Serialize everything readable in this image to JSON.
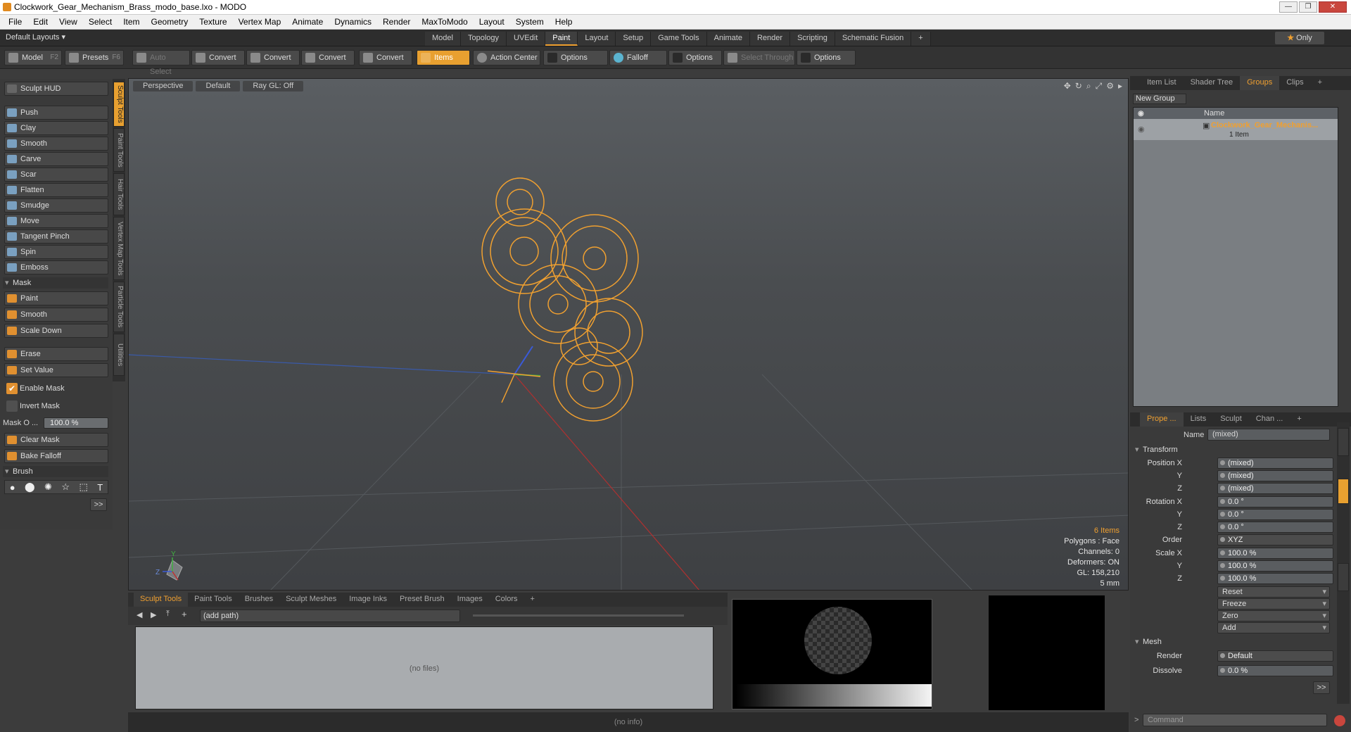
{
  "window": {
    "title": "Clockwork_Gear_Mechanism_Brass_modo_base.lxo - MODO",
    "controls": [
      "—",
      "❐",
      "✕"
    ]
  },
  "menu": [
    "File",
    "Edit",
    "View",
    "Select",
    "Item",
    "Geometry",
    "Texture",
    "Vertex Map",
    "Animate",
    "Dynamics",
    "Render",
    "MaxToModo",
    "Layout",
    "System",
    "Help"
  ],
  "layout": {
    "default_layouts": "Default Layouts ▾",
    "tabs": [
      "Model",
      "Topology",
      "UVEdit",
      "Paint",
      "Layout",
      "Setup",
      "Game Tools",
      "Animate",
      "Render",
      "Scripting",
      "Schematic Fusion",
      "+"
    ],
    "active_tab": 3,
    "only": "Only"
  },
  "toolbar": {
    "model": "Model",
    "model_key": "F2",
    "presets": "Presets",
    "presets_key": "F6",
    "auto_select": "Auto Select",
    "convert1": "Convert",
    "convert2": "Convert",
    "convert3": "Convert",
    "convert4": "Convert",
    "items": "Items",
    "action_center": "Action Center",
    "options1": "Options",
    "falloff": "Falloff",
    "options2": "Options",
    "select_through": "Select Through",
    "options3": "Options"
  },
  "sculpt": {
    "hud": "Sculpt HUD",
    "tools": [
      "Push",
      "Clay",
      "Smooth",
      "Carve",
      "Scar",
      "Flatten",
      "Smudge",
      "Move",
      "Tangent Pinch",
      "Spin",
      "Emboss"
    ],
    "mask_section": "Mask",
    "mask_tools": [
      "Paint",
      "Smooth",
      "Scale Down"
    ],
    "erase": "Erase",
    "set_value": "Set Value",
    "enable_mask": "Enable Mask",
    "invert_mask": "Invert Mask",
    "mask_opacity_label": "Mask O ...",
    "mask_opacity_value": "100.0 %",
    "clear_mask": "Clear Mask",
    "bake_falloff": "Bake Falloff",
    "brush_section": "Brush",
    "more": ">>"
  },
  "side_tabs": [
    "Sculpt Tools",
    "Paint Tools",
    "Hair Tools",
    "Vertex Map Tools",
    "Particle Tools",
    "Utilities"
  ],
  "viewport": {
    "view": "Perspective",
    "shading": "Default",
    "raygl": "Ray GL: Off",
    "info": {
      "items": "6 Items",
      "polygons": "Polygons : Face",
      "channels": "Channels: 0",
      "deformers": "Deformers: ON",
      "gl": "GL: 158,210",
      "scale": "5 mm"
    },
    "axis_y": "Y",
    "axis_z": "Z"
  },
  "bottom": {
    "tabs": [
      "Sculpt Tools",
      "Paint Tools",
      "Brushes",
      "Sculpt Meshes",
      "Image Inks",
      "Preset Brush",
      "Images",
      "Colors",
      "+"
    ],
    "path": "(add path)",
    "no_files": "(no files)",
    "status": "(no info)"
  },
  "right": {
    "top_tabs": [
      "Item List",
      "Shader Tree",
      "Groups",
      "Clips",
      "+"
    ],
    "new_group": "New Group",
    "col_name": "Name",
    "group_name": "Clockwork_Gear_Mechanis...",
    "group_count": "1 Item",
    "prop_tabs": [
      "Prope ...",
      "Lists",
      "Sculpt",
      "Chan ...",
      "+"
    ],
    "name_label": "Name",
    "name_value": "(mixed)",
    "transform": "Transform",
    "position_x_label": "Position X",
    "position_x": "(mixed)",
    "position_y_label": "Y",
    "position_y": "(mixed)",
    "position_z_label": "Z",
    "position_z": "(mixed)",
    "rotation_x_label": "Rotation X",
    "rotation_x": "0.0 °",
    "rotation_y_label": "Y",
    "rotation_y": "0.0 °",
    "rotation_z_label": "Z",
    "rotation_z": "0.0 °",
    "order_label": "Order",
    "order": "XYZ",
    "scale_x_label": "Scale X",
    "scale_x": "100.0 %",
    "scale_y_label": "Y",
    "scale_y": "100.0 %",
    "scale_z_label": "Z",
    "scale_z": "100.0 %",
    "reset": "Reset",
    "freeze": "Freeze",
    "zero": "Zero",
    "add": "Add",
    "mesh": "Mesh",
    "render_label": "Render",
    "render": "Default",
    "dissolve_label": "Dissolve",
    "dissolve": "0.0 %",
    "more": ">>",
    "command": "Command"
  },
  "colors": {
    "accent": "#f0a030",
    "mesh": "#f0a030"
  }
}
